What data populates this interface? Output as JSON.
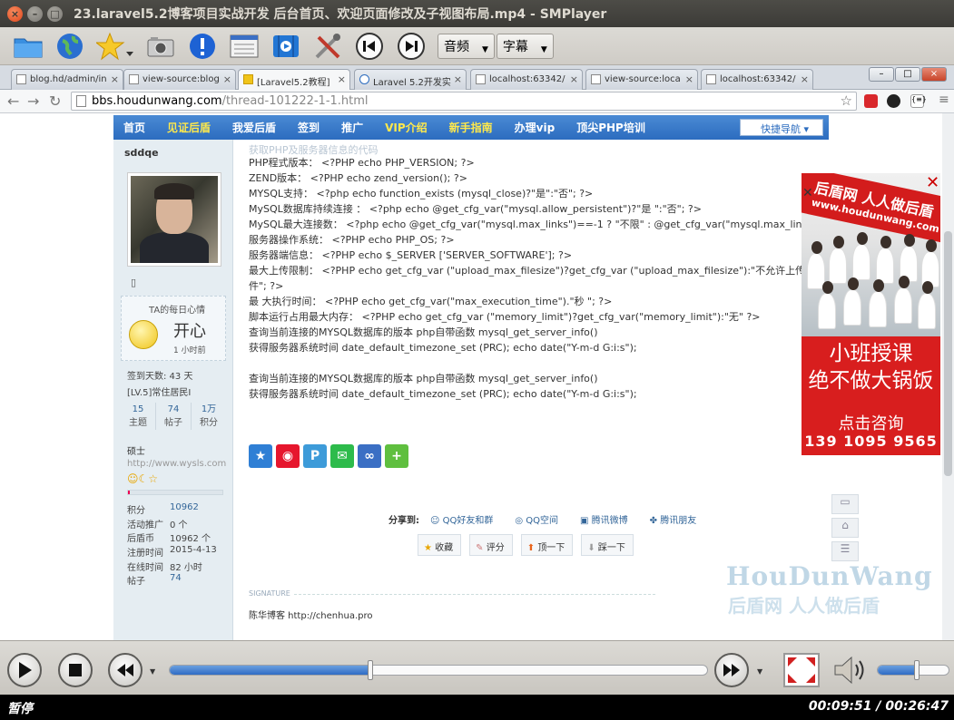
{
  "window": {
    "title": "23.laravel5.2博客项目实战开发 后台首页、欢迎页面修改及子视图布局.mp4 - SMPlayer"
  },
  "toolbar": {
    "icons": [
      "folder-icon",
      "globe-icon",
      "favorites-icon",
      "screenshot-icon",
      "info-icon",
      "playlist-icon",
      "video-settings-icon",
      "tools-icon",
      "previous-icon",
      "next-icon"
    ],
    "audio_label": "音频",
    "subtitle_label": "字幕"
  },
  "browser": {
    "tabs": [
      {
        "label": "blog.hd/admin/in"
      },
      {
        "label": "view-source:blog"
      },
      {
        "label": "[Laravel5.2教程]"
      },
      {
        "label": "Laravel 5.2开发实"
      },
      {
        "label": "localhost:63342/"
      },
      {
        "label": "view-source:loca"
      },
      {
        "label": "localhost:63342/"
      }
    ],
    "url_host": "bbs.houdunwang.com",
    "url_path": "/thread-101222-1-1.html"
  },
  "forum": {
    "nav": [
      {
        "label": "首页",
        "yellow": false
      },
      {
        "label": "见证后盾",
        "yellow": true
      },
      {
        "label": "我爱后盾",
        "yellow": false
      },
      {
        "label": "签到",
        "yellow": false
      },
      {
        "label": "推广",
        "yellow": false
      },
      {
        "label": "VIP介绍",
        "yellow": true
      },
      {
        "label": "新手指南",
        "yellow": true
      },
      {
        "label": "办理vip",
        "yellow": false
      },
      {
        "label": "顶尖PHP培训",
        "yellow": false
      }
    ],
    "quicknav": "快捷导航"
  },
  "user": {
    "name": "sddqe",
    "mood_title": "TA的每日心情",
    "mood": "开心",
    "mood_time": "1 小时前",
    "signin_days": "签到天数: 43 天",
    "level": "[LV.5]常住居民I",
    "stats": [
      {
        "n": "15",
        "label": "主题"
      },
      {
        "n": "74",
        "label": "帖子"
      },
      {
        "n": "1万",
        "label": "积分"
      }
    ],
    "rank": "硕士",
    "site": "http://www.wysls.com",
    "info": [
      {
        "k": "积分",
        "v": "10962",
        "blue": true
      },
      {
        "k": "活动推广",
        "v": "0 个",
        "blue": false
      },
      {
        "k": "后盾币",
        "v": "10962 个",
        "blue": false
      },
      {
        "k": "注册时间",
        "v": "2015-4-13",
        "blue": false
      },
      {
        "k": "在线时间",
        "v": "82 小时",
        "blue": false
      },
      {
        "k": "帖子",
        "v": "74",
        "blue": true
      }
    ]
  },
  "post": {
    "ghost": "获取PHP及服务器信息的代码",
    "lines": [
      "PHP程式版本： <?PHP echo PHP_VERSION; ?>",
      "ZEND版本： <?PHP echo zend_version(); ?>",
      "MYSQL支持： <?php echo function_exists (mysql_close)?\"是\":\"否\"; ?>",
      "MySQL数据库持续连接 ： <?php echo @get_cfg_var(\"mysql.allow_persistent\")?\"是 \":\"否\"; ?>",
      "MySQL最大连接数： <?php echo @get_cfg_var(\"mysql.max_links\")==-1 ? \"不限\" : @get_cfg_var(\"mysql.max_links\");",
      "服务器操作系统： <?PHP echo PHP_OS; ?>",
      "服务器端信息： <?PHP echo $_SERVER ['SERVER_SOFTWARE']; ?>",
      "最大上传限制： <?PHP echo get_cfg_var (\"upload_max_filesize\")?get_cfg_var (\"upload_max_filesize\"):\"不允许上传附",
      "件\"; ?>",
      "最 大执行时间： <?PHP echo get_cfg_var(\"max_execution_time\").\"秒 \"; ?>",
      "脚本运行占用最大内存： <?PHP echo get_cfg_var (\"memory_limit\")?get_cfg_var(\"memory_limit\"):\"无\" ?>",
      "查询当前连接的MYSQL数据库的版本 php自带函数 mysql_get_server_info()",
      "获得服务器系统时间 date_default_timezone_set (PRC); echo date(\"Y-m-d G:i:s\");",
      "",
      "查询当前连接的MYSQL数据库的版本 php自带函数 mysql_get_server_info()",
      "获得服务器系统时间 date_default_timezone_set (PRC); echo date(\"Y-m-d G:i:s\");"
    ],
    "share_label": "分享到:",
    "share_targets": [
      "QQ好友和群",
      "QQ空间",
      "腾讯微博",
      "腾讯朋友"
    ],
    "actions": [
      "收藏",
      "评分",
      "顶一下",
      "踩一下"
    ],
    "signature_label": "SIGNATURE",
    "signature": "陈华博客 http://chenhua.pro",
    "watermark_top": "HouDunWang",
    "watermark_bottom": "后盾网 人人做后盾"
  },
  "ad": {
    "banner": "后盾网 人人做后盾",
    "banner_url": "www.houdunwang.com",
    "title1": "小班授课",
    "title2": "绝不做大锅饭",
    "consult": "点击咨询",
    "phone": "139 1095 9565"
  },
  "player": {
    "progress": 0.373,
    "volume": 0.55,
    "status": "暂停",
    "time": "00:09:51 / 00:26:47"
  }
}
